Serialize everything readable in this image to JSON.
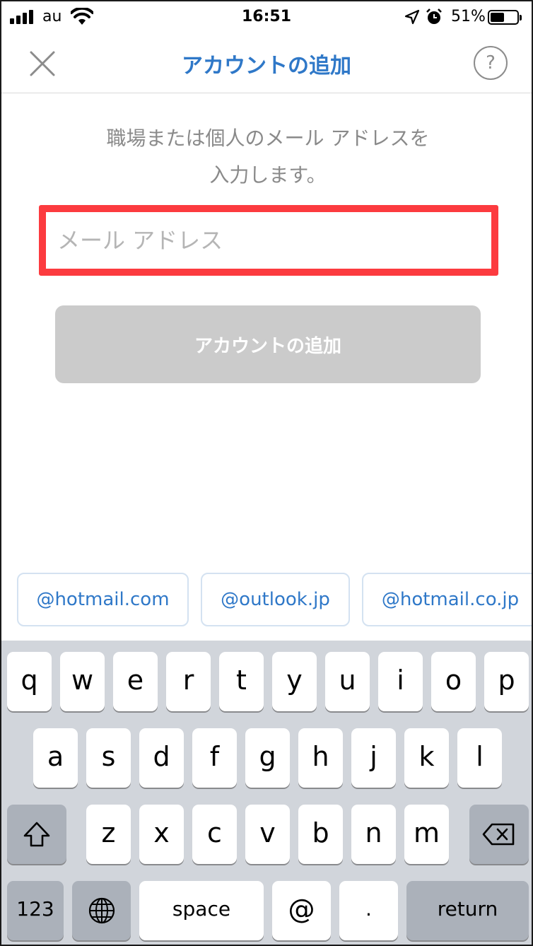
{
  "status_bar": {
    "carrier": "au",
    "time": "16:51",
    "battery_percent": "51%",
    "battery_level": 0.51
  },
  "nav": {
    "title": "アカウントの追加",
    "close_icon": "close-icon",
    "help_label": "?"
  },
  "main": {
    "instruction_line1": "職場または個人のメール アドレスを",
    "instruction_line2": "入力します。",
    "email_placeholder": "メール アドレス",
    "email_value": "",
    "add_button_label": "アカウントの追加"
  },
  "domain_suggestions": [
    "@hotmail.com",
    "@outlook.jp",
    "@hotmail.co.jp"
  ],
  "keyboard": {
    "row1": [
      "q",
      "w",
      "e",
      "r",
      "t",
      "y",
      "u",
      "i",
      "o",
      "p"
    ],
    "row2": [
      "a",
      "s",
      "d",
      "f",
      "g",
      "h",
      "j",
      "k",
      "l"
    ],
    "row3": [
      "z",
      "x",
      "c",
      "v",
      "b",
      "n",
      "m"
    ],
    "numbers_label": "123",
    "space_label": "space",
    "at_label": "@",
    "dot_label": ".",
    "return_label": "return",
    "shift_icon": "shift-icon",
    "delete_icon": "delete-icon",
    "globe_icon": "globe-icon"
  },
  "colors": {
    "accent": "#2f78c8",
    "highlight": "#fc3b3f",
    "disabled_button": "#cbcbcb",
    "keyboard_bg": "#d1d5db"
  }
}
